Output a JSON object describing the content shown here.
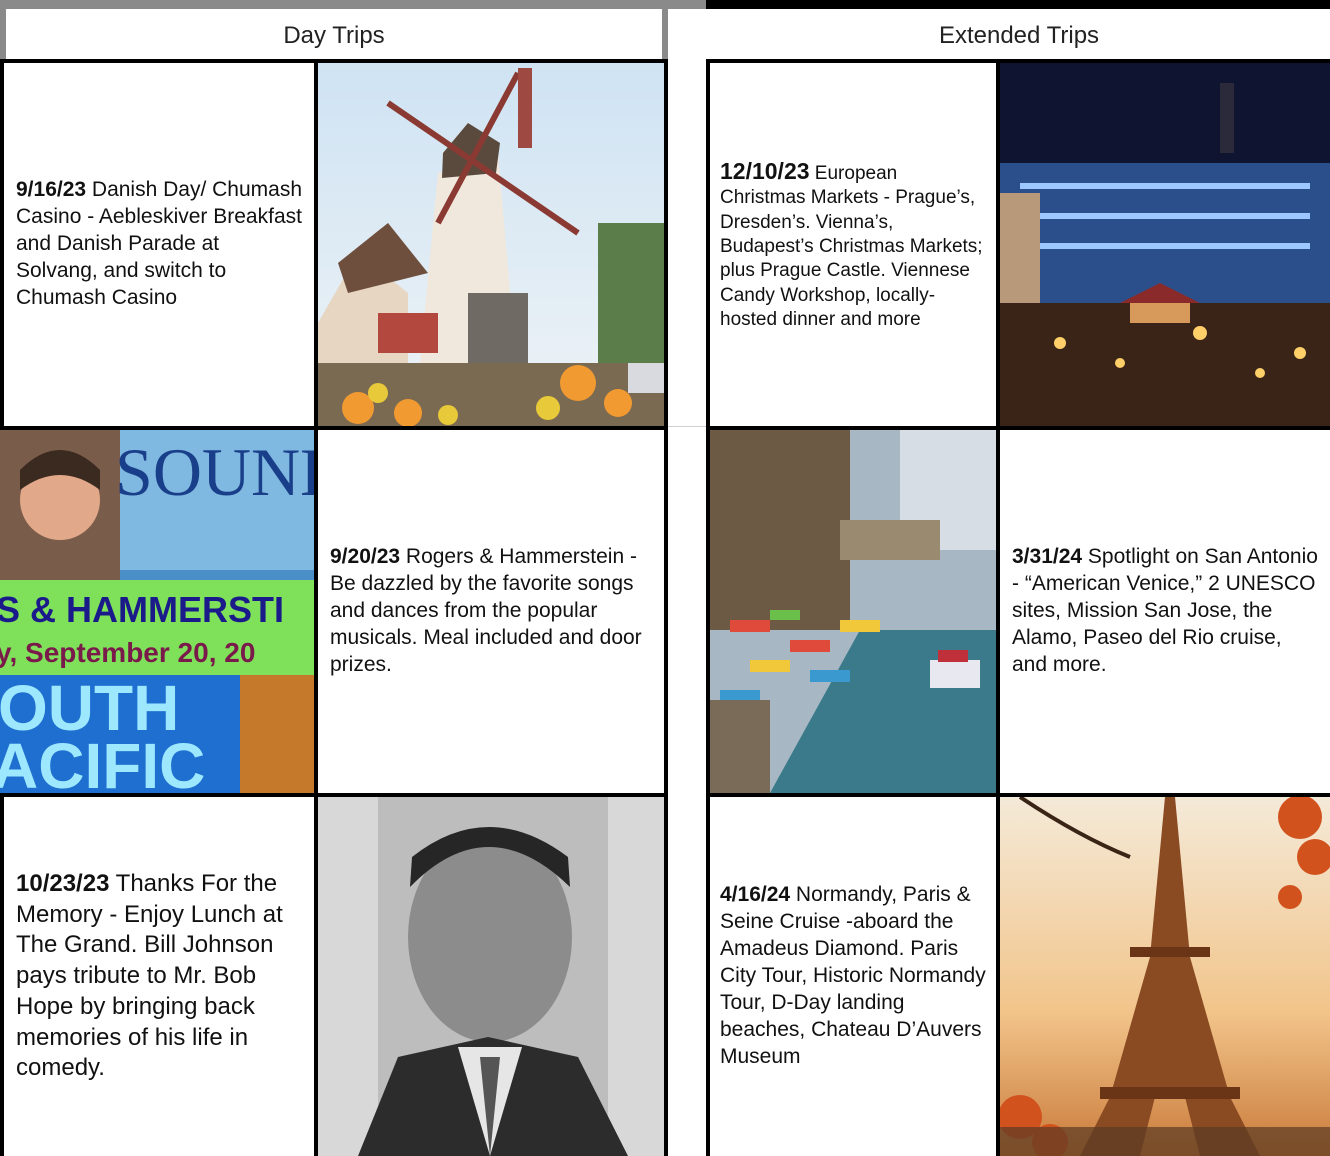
{
  "columns": {
    "day": {
      "header": "Day Trips"
    },
    "extended": {
      "header": "Extended Trips"
    }
  },
  "day_trips": [
    {
      "date": "9/16/23",
      "text": " Danish Day/ Chumash Casino - Aebleskiver Breakfast and Danish Parade at Solvang, and switch to Chumash Casino",
      "image": "solvang-windmill-photo"
    },
    {
      "date": "9/20/23",
      "text": " Rogers & Hammerstein - Be dazzled by the favorite songs and dances from the popular musicals.  Meal included and door prizes.",
      "image": "sound-of-music-poster-collage",
      "poster": {
        "top": "SOUND",
        "band1": "S & HAMMERSTI",
        "band2": "y, September 20, 20",
        "bottom1": "OUTH",
        "bottom2": "ACIFIC"
      }
    },
    {
      "date": "10/23/23",
      "text": " Thanks For the Memory - Enjoy Lunch at The Grand. Bill Johnson pays tribute to Mr. Bob Hope by bringing back memories of his life in comedy.",
      "image": "bob-hope-portrait-photo"
    }
  ],
  "extended_trips": [
    {
      "date": "12/10/23",
      "text": " European Christmas Markets - Prague’s, Dresden’s. Vienna’s, Budapest’s Christmas Markets; plus Prague Castle. Viennese Candy Workshop, locally-hosted dinner and more",
      "image": "christmas-market-night-photo"
    },
    {
      "date": "3/31/24",
      "text": " Spotlight on San Antonio - “American Venice,” 2 UNESCO sites, Mission San Jose, the Alamo, Paseo del Rio cruise, and more.",
      "image": "san-antonio-riverwalk-photo"
    },
    {
      "date": "4/16/24",
      "text": " Normandy, Paris & Seine Cruise -aboard the Amadeus Diamond. Paris City Tour, Historic Normandy Tour, D-Day landing beaches, Chateau D’Auvers Museum",
      "image": "eiffel-tower-autumn-photo"
    }
  ]
}
